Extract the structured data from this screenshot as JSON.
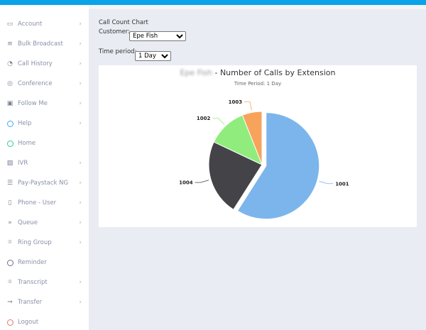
{
  "sidebar": {
    "items": [
      {
        "label": "Account",
        "icon": "account-icon",
        "chevron": true
      },
      {
        "label": "Bulk Broadcast",
        "icon": "list-icon",
        "chevron": true
      },
      {
        "label": "Call History",
        "icon": "gauge-icon",
        "chevron": true
      },
      {
        "label": "Conference",
        "icon": "conference-icon",
        "chevron": true
      },
      {
        "label": "Follow Me",
        "icon": "id-card-icon",
        "chevron": true
      },
      {
        "label": "Help",
        "icon": "circle-icon",
        "chevron": true,
        "color": "#3fa9f5"
      },
      {
        "label": "Home",
        "icon": "circle-icon",
        "chevron": false,
        "color": "#2ecc8f"
      },
      {
        "label": "IVR",
        "icon": "image-icon",
        "chevron": true
      },
      {
        "label": "Pay-Paystack NG",
        "icon": "document-icon",
        "chevron": true
      },
      {
        "label": "Phone - User",
        "icon": "phone-icon",
        "chevron": true
      },
      {
        "label": "Queue",
        "icon": "double-chevron-icon",
        "chevron": true
      },
      {
        "label": "Ring Group",
        "icon": "location-pin-icon",
        "chevron": true
      },
      {
        "label": "Reminder",
        "icon": "circle-icon",
        "chevron": false,
        "color": "#6b7085"
      },
      {
        "label": "Transcript",
        "icon": "location-pin-icon",
        "chevron": true
      },
      {
        "label": "Transfer",
        "icon": "arrow-right-icon",
        "chevron": true
      },
      {
        "label": "Logout",
        "icon": "circle-icon",
        "chevron": false,
        "color": "#e57373"
      }
    ]
  },
  "main": {
    "heading": "Call Count Chart",
    "customer_label": "Customer:",
    "customer_value": "Epe Fish",
    "period_label": "Time period:",
    "period_value": "1 Day"
  },
  "chart_data": {
    "type": "pie",
    "title_customer": "Epe Fish",
    "title": " - Number of Calls by Extension",
    "subtitle": "Time Period: 1 Day",
    "categories": [
      "1001",
      "1004",
      "1002",
      "1003"
    ],
    "values": [
      59,
      23,
      12,
      6
    ],
    "colors": [
      "#7cb5ec",
      "#434348",
      "#90ed7d",
      "#f7a35c"
    ],
    "sliced": "1001"
  }
}
